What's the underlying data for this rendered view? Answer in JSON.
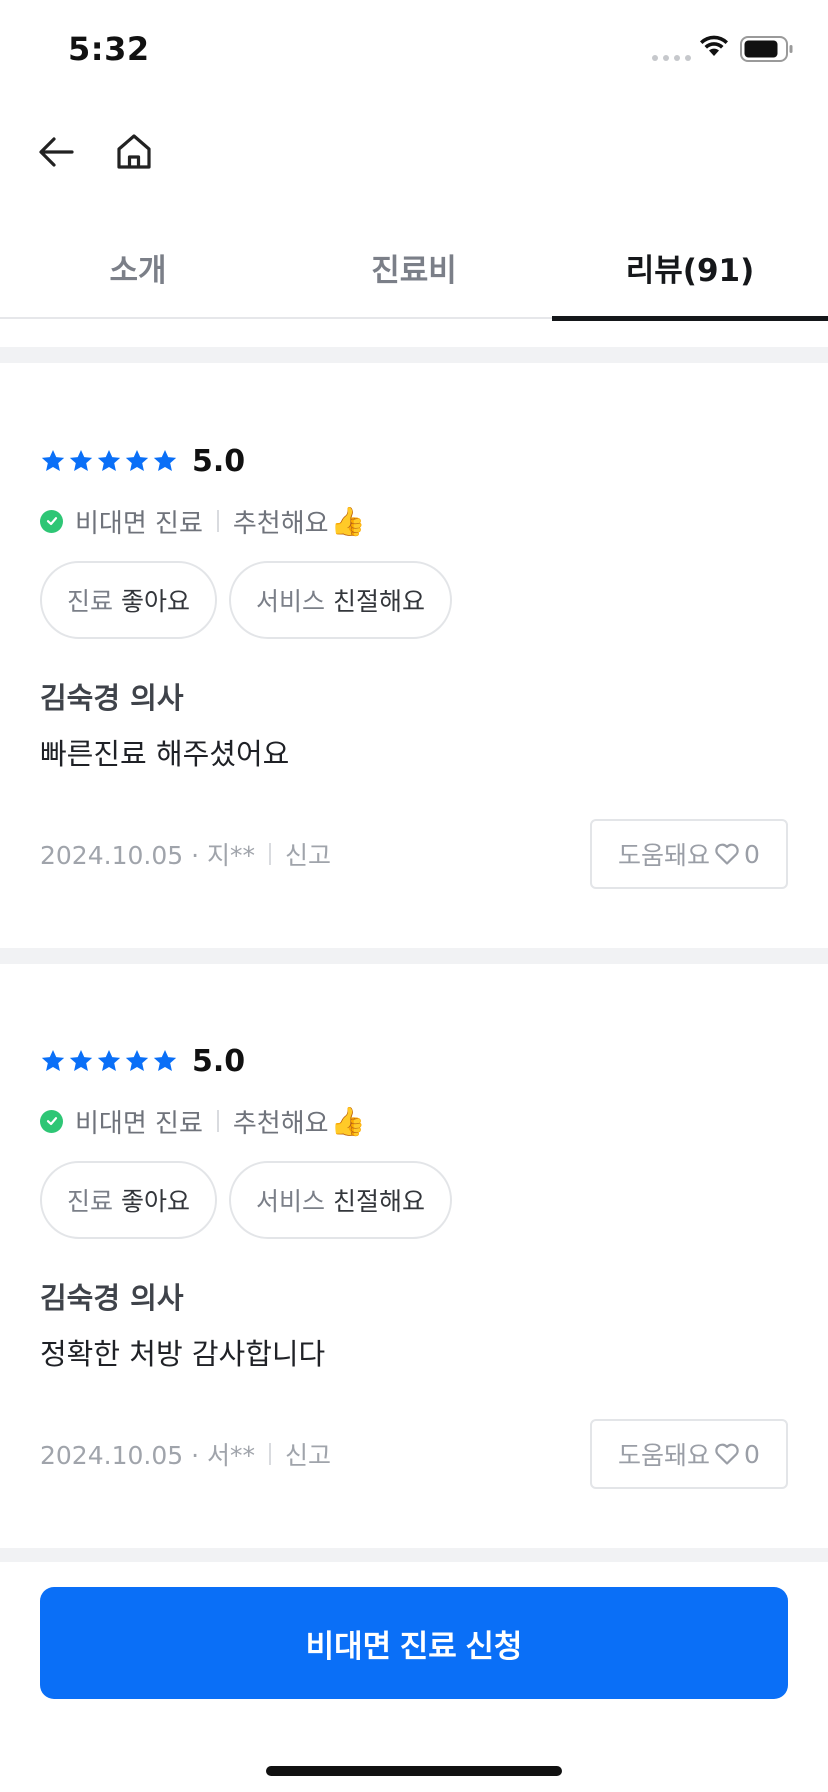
{
  "status_bar": {
    "time": "5:32"
  },
  "tabs": [
    {
      "label": "소개"
    },
    {
      "label": "진료비"
    },
    {
      "label": "리뷰(91)"
    }
  ],
  "reviews": [
    {
      "score": "5.0",
      "stars": 5,
      "type": "비대면 진료",
      "recommend": "추천해요",
      "recommend_emoji": "👍",
      "chips": [
        {
          "prefix": "진료",
          "value": "좋아요"
        },
        {
          "prefix": "서비스",
          "value": "친절해요"
        }
      ],
      "doctor": "김숙경 의사",
      "content": "빠른진료 해주셨어요",
      "date_author": "2024.10.05 · 지**",
      "report": "신고",
      "helpful_label": "도움돼요",
      "helpful_count": "0"
    },
    {
      "score": "5.0",
      "stars": 5,
      "type": "비대면 진료",
      "recommend": "추천해요",
      "recommend_emoji": "👍",
      "chips": [
        {
          "prefix": "진료",
          "value": "좋아요"
        },
        {
          "prefix": "서비스",
          "value": "친절해요"
        }
      ],
      "doctor": "김숙경 의사",
      "content": "정확한 처방 감사합니다",
      "date_author": "2024.10.05 · 서**",
      "report": "신고",
      "helpful_label": "도움돼요",
      "helpful_count": "0"
    }
  ],
  "cta": {
    "label": "비대면 진료 신청"
  },
  "colors": {
    "accent": "#0a6ff7",
    "star": "#0a6ff7",
    "check": "#2ec675"
  }
}
